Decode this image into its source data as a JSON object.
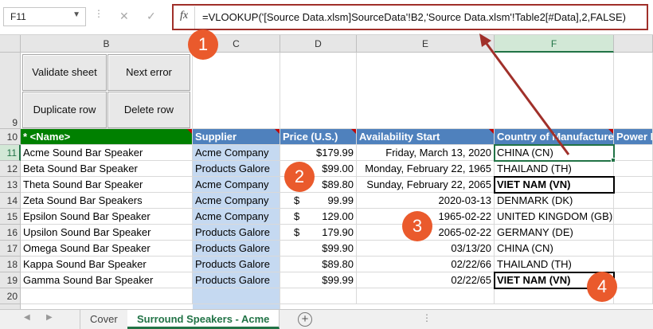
{
  "formula_bar": {
    "name_box": "F11",
    "cancel_symbol": "✕",
    "enter_symbol": "✓",
    "fx": "fx",
    "formula": "=VLOOKUP('[Source Data.xlsm]SourceData'!B2,'Source Data.xlsm'!Table2[#Data],2,FALSE)"
  },
  "columns": [
    "B",
    "C",
    "D",
    "E",
    "F"
  ],
  "rows": [
    "9",
    "10",
    "11",
    "12",
    "13",
    "14",
    "15",
    "16",
    "17",
    "18",
    "19",
    "20"
  ],
  "buttons": {
    "validate": "Validate sheet",
    "next_error": "Next error",
    "duplicate": "Duplicate row",
    "delete": "Delete row"
  },
  "headers": {
    "name": "* <Name>",
    "supplier": "Supplier",
    "price": "Price (U.S.)",
    "availability": "Availability Start",
    "country": "Country of Manufacture",
    "power": "Power F"
  },
  "table_rows": [
    {
      "name": "Acme Sound Bar Speaker",
      "supplier": "Acme Company",
      "price": "$179.99",
      "price_sym": "",
      "avail": "Friday, March 13, 2020",
      "country": "CHINA (CN)"
    },
    {
      "name": "Beta Sound Bar Speaker",
      "supplier": "Products Galore",
      "price": "$99.00",
      "price_sym": "",
      "avail": "Monday, February 22, 1965",
      "country": "THAILAND (TH)"
    },
    {
      "name": "Theta Sound Bar Speaker",
      "supplier": "Acme Company",
      "price": "$89.80",
      "price_sym": "",
      "avail": "Sunday, February 22, 2065",
      "country": "VIET NAM (VN)"
    },
    {
      "name": "Zeta Sound Bar Speakers",
      "supplier": "Acme Company",
      "price": "99.99",
      "price_sym": "$",
      "avail": "2020-03-13",
      "country": "DENMARK (DK)"
    },
    {
      "name": "Epsilon Sound Bar Speaker",
      "supplier": "Acme Company",
      "price": "129.00",
      "price_sym": "$",
      "avail": "1965-02-22",
      "country": "UNITED KINGDOM (GB)"
    },
    {
      "name": "Upsilon Sound Bar Speaker",
      "supplier": "Products Galore",
      "price": "179.90",
      "price_sym": "$",
      "avail": "2065-02-22",
      "country": "GERMANY (DE)"
    },
    {
      "name": "Omega Sound Bar Speaker",
      "supplier": "Products Galore",
      "price": "$99.90",
      "price_sym": "",
      "avail": "03/13/20",
      "country": "CHINA (CN)"
    },
    {
      "name": "Kappa Sound Bar Speaker",
      "supplier": "Products Galore",
      "price": "$89.80",
      "price_sym": "",
      "avail": "02/22/66",
      "country": "THAILAND (TH)"
    },
    {
      "name": "Gamma Sound Bar Speaker",
      "supplier": "Products Galore",
      "price": "$99.99",
      "price_sym": "",
      "avail": "02/22/65",
      "country": "VIET NAM (VN)"
    }
  ],
  "tabs": {
    "cover": "Cover",
    "active": "Surround Speakers - Acme",
    "add": "+",
    "more": "⋮"
  },
  "callouts": [
    "1",
    "2",
    "3",
    "4"
  ],
  "colors": {
    "accent": "#217346",
    "callout": "#ea5a2c",
    "arrow": "#a0302a",
    "header_blue": "#4f81bd",
    "header_green": "#008000",
    "supplier_blue": "#c5d9f1"
  }
}
